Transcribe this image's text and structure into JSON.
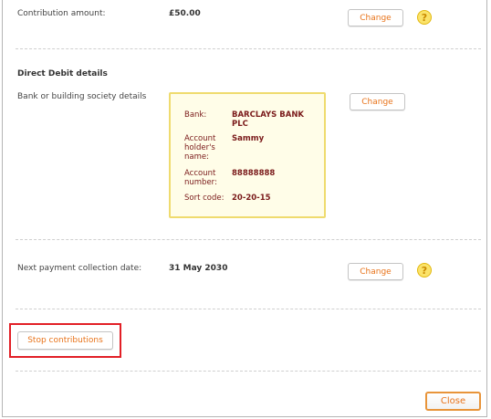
{
  "contribution": {
    "label": "Contribution amount:",
    "value": "£50.00",
    "change_label": "Change",
    "help_glyph": "?"
  },
  "direct_debit": {
    "heading": "Direct Debit details",
    "bank_label": "Bank or building society details",
    "change_label": "Change",
    "bank": {
      "bank_label": "Bank:",
      "bank_value": "BARCLAYS BANK PLC",
      "holder_label": "Account holder's name:",
      "holder_value": "Sammy",
      "number_label": "Account number:",
      "number_value": "88888888",
      "sort_label": "Sort code:",
      "sort_value": "20-20-15"
    }
  },
  "next_payment": {
    "label": "Next payment collection date:",
    "value": "31 May 2030",
    "change_label": "Change",
    "help_glyph": "?"
  },
  "actions": {
    "stop_label": "Stop contributions",
    "close_label": "Close"
  },
  "colors": {
    "accent": "#e8731a",
    "highlight_border": "#e21f26",
    "bank_box_bg": "#fffde8",
    "bank_text": "#7a1a1a"
  }
}
